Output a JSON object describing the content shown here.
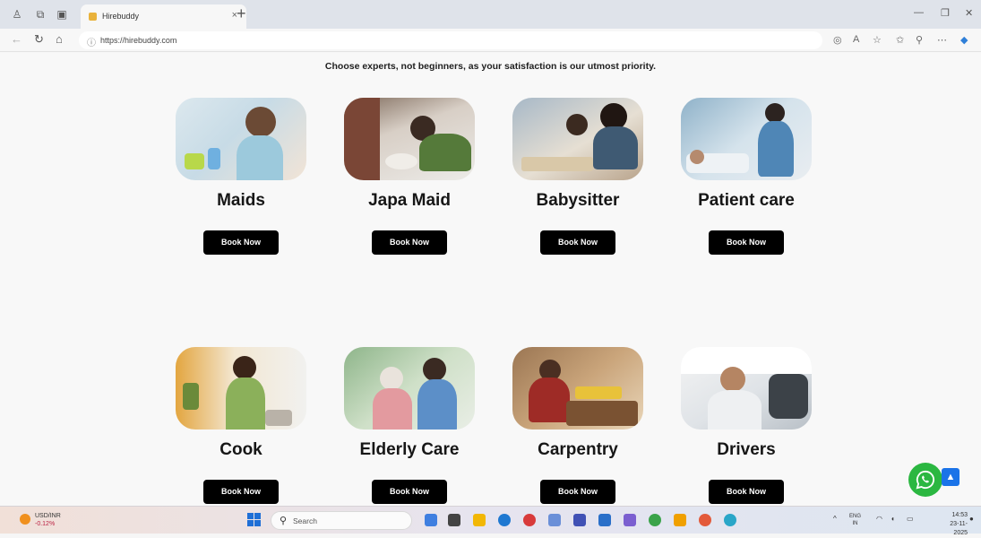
{
  "browser": {
    "tab_title": "Hirebuddy",
    "tab_close": "×",
    "new_tab": "+",
    "url": "https://hirebuddy.com"
  },
  "page": {
    "tagline": "Choose experts, not beginners, as your satisfaction is our utmost priority.",
    "services": [
      {
        "name": "Maids",
        "button": "Book Now"
      },
      {
        "name": "Japa Maid",
        "button": "Book Now"
      },
      {
        "name": "Babysitter",
        "button": "Book Now"
      },
      {
        "name": "Patient care",
        "button": "Book Now"
      },
      {
        "name": "Cook",
        "button": "Book Now"
      },
      {
        "name": "Elderly Care",
        "button": "Book Now"
      },
      {
        "name": "Carpentry",
        "button": "Book Now"
      },
      {
        "name": "Drivers",
        "button": "Book Now"
      }
    ]
  },
  "taskbar": {
    "weather_label": "USD/INR",
    "weather_value": "-0.12%",
    "search_placeholder": "Search",
    "lang_top": "ENG",
    "lang_bottom": "IN",
    "time": "14:53",
    "date": "23-11-2025"
  },
  "colors": {
    "accent_whatsapp": "#2bb741",
    "scroll_top": "#1a73e8",
    "book_button": "#000000"
  }
}
